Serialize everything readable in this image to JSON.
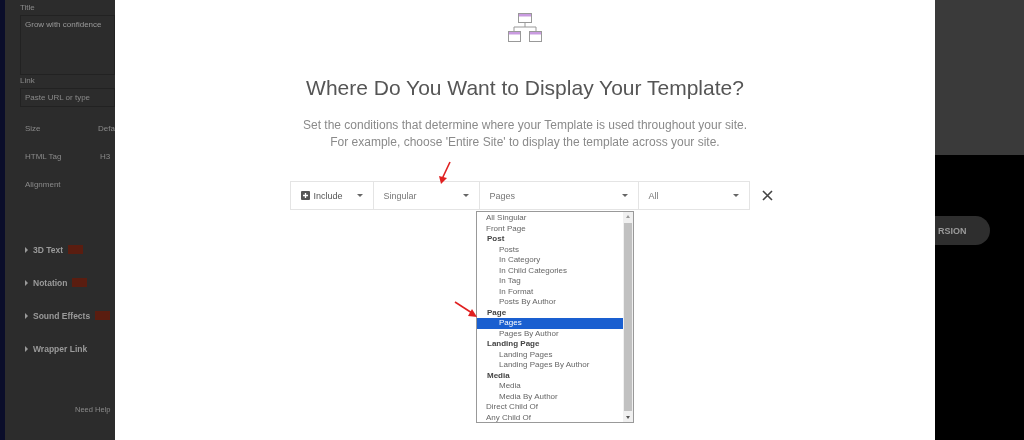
{
  "editor_panel": {
    "fields": [
      {
        "label": "Title",
        "value": "Grow with confidence"
      },
      {
        "label": "Link",
        "placeholder": "Paste URL or type"
      }
    ],
    "settings": [
      {
        "label": "Size",
        "value": "Defa"
      },
      {
        "label": "HTML Tag",
        "value": "H3"
      },
      {
        "label": "Alignment"
      }
    ],
    "sections": [
      {
        "label": "3D Text",
        "badge": true
      },
      {
        "label": "Notation",
        "badge": true
      },
      {
        "label": "Sound Effects",
        "badge": true
      },
      {
        "label": "Wrapper Link",
        "badge": false
      }
    ],
    "help": "Need Help"
  },
  "right_button": "RSION",
  "modal": {
    "heading": "Where Do You Want to Display Your Template?",
    "description": [
      "Set the conditions that determine where your Template is used throughout your site.",
      "For example, choose 'Entire Site' to display the template across your site."
    ],
    "condition": {
      "type": "Include",
      "rule": "Singular",
      "target": "Pages",
      "scope": "All"
    },
    "dropdown": [
      {
        "label": "All Singular",
        "selected": false
      },
      {
        "label": "Front Page",
        "selected": false
      },
      {
        "label": "Post",
        "children": [
          {
            "label": "Posts",
            "selected": false
          },
          {
            "label": "In Category",
            "selected": false
          },
          {
            "label": "In Child Categories",
            "selected": false
          },
          {
            "label": "In Tag",
            "selected": false
          },
          {
            "label": "In Format",
            "selected": false
          },
          {
            "label": "Posts By Author",
            "selected": false
          }
        ]
      },
      {
        "label": "Page",
        "children": [
          {
            "label": "Pages",
            "selected": true
          },
          {
            "label": "Pages By Author",
            "selected": false
          }
        ]
      },
      {
        "label": "Landing Page",
        "children": [
          {
            "label": "Landing Pages",
            "selected": false
          },
          {
            "label": "Landing Pages By Author",
            "selected": false
          }
        ]
      },
      {
        "label": "Media",
        "children": [
          {
            "label": "Media",
            "selected": false
          },
          {
            "label": "Media By Author",
            "selected": false
          }
        ]
      },
      {
        "label": "Direct Child Of",
        "selected": false
      },
      {
        "label": "Any Child Of",
        "selected": false
      }
    ]
  }
}
